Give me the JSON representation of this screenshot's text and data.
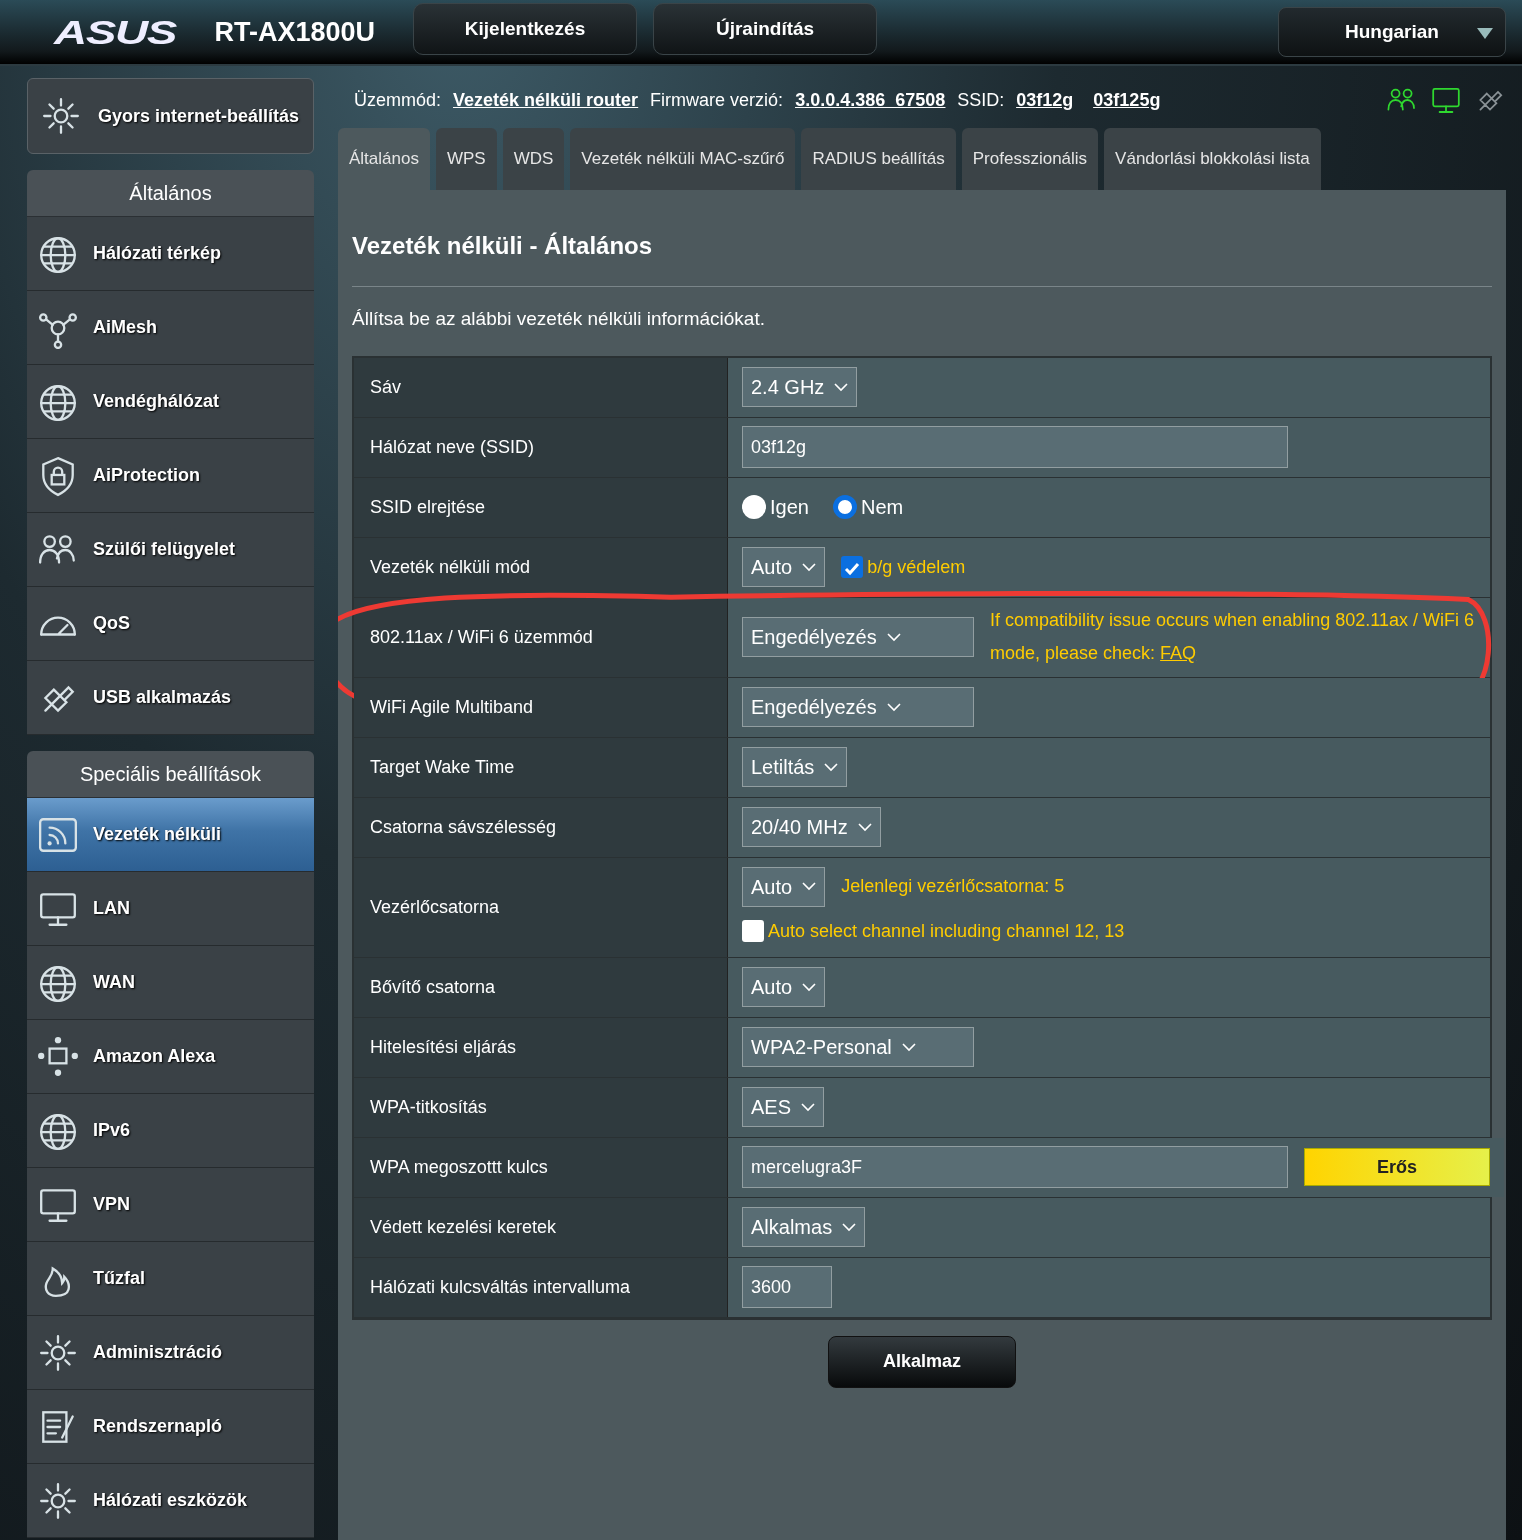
{
  "header": {
    "logo": "ASUS",
    "model": "RT-AX1800U",
    "buttons": [
      "Kijelentkezés",
      "Újraindítás"
    ],
    "language": "Hungarian"
  },
  "status": {
    "mode_label": "Üzemmód:",
    "mode": "Vezeték nélküli router",
    "firmware_label": "Firmware verzió:",
    "firmware": "3.0.0.4.386_67508",
    "ssid_label": "SSID:",
    "ssids": [
      "03f12g",
      "03f125g"
    ]
  },
  "sidebar": {
    "quick_setup": "Gyors internet-beállítás",
    "sections": [
      {
        "title": "Általános",
        "items": [
          {
            "label": "Hálózati térkép",
            "selected": false
          },
          {
            "label": "AiMesh",
            "selected": false
          },
          {
            "label": "Vendéghálózat",
            "selected": false
          },
          {
            "label": "AiProtection",
            "selected": false
          },
          {
            "label": "Szülői felügyelet",
            "selected": false
          },
          {
            "label": "QoS",
            "selected": false
          },
          {
            "label": "USB alkalmazás",
            "selected": false
          }
        ]
      },
      {
        "title": "Speciális beállítások",
        "items": [
          {
            "label": "Vezeték nélküli",
            "selected": true
          },
          {
            "label": "LAN",
            "selected": false
          },
          {
            "label": "WAN",
            "selected": false
          },
          {
            "label": "Amazon Alexa",
            "selected": false
          },
          {
            "label": "IPv6",
            "selected": false
          },
          {
            "label": "VPN",
            "selected": false
          },
          {
            "label": "Tűzfal",
            "selected": false
          },
          {
            "label": "Adminisztráció",
            "selected": false
          },
          {
            "label": "Rendszernapló",
            "selected": false
          },
          {
            "label": "Hálózati eszközök",
            "selected": false
          }
        ]
      }
    ]
  },
  "tabs": [
    {
      "label": "Általános",
      "selected": true
    },
    {
      "label": "WPS",
      "selected": false
    },
    {
      "label": "WDS",
      "selected": false
    },
    {
      "label": "Vezeték nélküli MAC-szűrő",
      "selected": false
    },
    {
      "label": "RADIUS beállítás",
      "selected": false
    },
    {
      "label": "Professzionális",
      "selected": false
    },
    {
      "label": "Vándorlási blokkolási lista",
      "selected": false
    }
  ],
  "panel": {
    "title": "Vezeték nélküli - Általános",
    "description": "Állítsa be az alábbi vezeték nélküli információkat.",
    "settings": [
      {
        "label": "Sáv",
        "kind": "select",
        "value": "2.4 GHz"
      },
      {
        "label": "Hálózat neve (SSID)",
        "kind": "input",
        "value": "03f12g"
      },
      {
        "label": "SSID elrejtése",
        "kind": "radio",
        "options": [
          {
            "label": "Igen",
            "selected": false
          },
          {
            "label": "Nem",
            "selected": true
          }
        ]
      },
      {
        "label": "Vezeték nélküli mód",
        "kind": "select",
        "value": "Auto",
        "check": {
          "label": "b/g védelem",
          "checked": true
        }
      },
      {
        "label": "802.11ax / WiFi 6 üzemmód",
        "kind": "select",
        "value": "Engedélyezés",
        "note": "If compatibility issue occurs when enabling 802.11ax / WiFi 6 mode, please check:",
        "link": "FAQ"
      },
      {
        "label": "WiFi Agile Multiband",
        "kind": "select",
        "value": "Engedélyezés"
      },
      {
        "label": "Target Wake Time",
        "kind": "select",
        "value": "Letiltás"
      },
      {
        "label": "Csatorna sávszélesség",
        "kind": "select",
        "value": "20/40 MHz"
      },
      {
        "label": "Vezérlőcsatorna",
        "kind": "select",
        "value": "Auto",
        "note": "Jelenlegi vezérlőcsatorna: 5",
        "check": {
          "label": "Auto select channel including channel 12, 13",
          "checked": false
        }
      },
      {
        "label": "Bővítő csatorna",
        "kind": "select",
        "value": "Auto"
      },
      {
        "label": "Hitelesítési eljárás",
        "kind": "select",
        "value": "WPA2-Personal"
      },
      {
        "label": "WPA-titkosítás",
        "kind": "select",
        "value": "AES"
      },
      {
        "label": "WPA megoszottt kulcs",
        "kind": "input",
        "value": "mercelugra3F",
        "strength": "Erős"
      },
      {
        "label": "Védett kezelési keretek",
        "kind": "select",
        "value": "Alkalmas"
      },
      {
        "label": "Hálózati kulcsváltás intervalluma",
        "kind": "input",
        "value": "3600"
      }
    ],
    "apply": "Alkalmaz"
  }
}
